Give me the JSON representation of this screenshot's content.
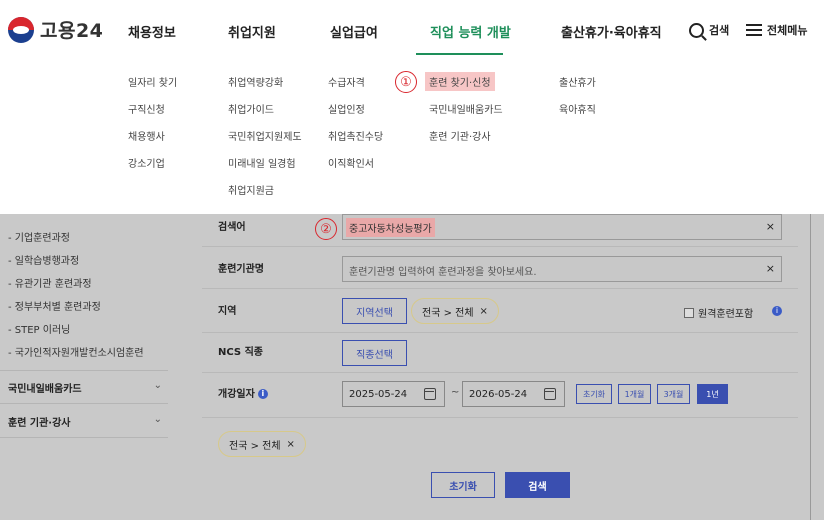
{
  "header": {
    "logo_text": "고용24",
    "nav": [
      "채용정보",
      "취업지원",
      "실업급여",
      "직업 능력 개발",
      "출산휴가·육아휴직"
    ],
    "search_label": "검색",
    "all_menu_label": "전체메뉴"
  },
  "mega_menu": {
    "col1": [
      "일자리 찾기",
      "구직신청",
      "채용행사",
      "강소기업"
    ],
    "col2": [
      "취업역량강화",
      "취업가이드",
      "국민취업지원제도",
      "미래내일 일경험",
      "취업지원금"
    ],
    "col3": [
      "수급자격",
      "실업인정",
      "취업촉진수당",
      "이직확인서"
    ],
    "col4": [
      "훈련 찾기·신청",
      "국민내일배움카드",
      "훈련 기관·강사"
    ],
    "col5": [
      "출산휴가",
      "육아휴직"
    ],
    "marker1": "①",
    "marker2": "②"
  },
  "sidebar": {
    "items": [
      "- 기업훈련과정",
      "- 일학습병행과정",
      "- 유관기관 훈련과정",
      "- 정부부처별 훈련과정",
      "- STEP 이러닝",
      "- 국가인적자원개발컨소시엄훈련"
    ],
    "groups": [
      "국민내일배움카드",
      "훈련 기관·강사"
    ]
  },
  "form": {
    "keyword_label": "검색어",
    "keyword_value": "중고자동차성능평가",
    "institution_label": "훈련기관명",
    "institution_placeholder": "훈련기관명 입력하여 훈련과정을 찾아보세요.",
    "region_label": "지역",
    "region_button": "지역선택",
    "region_chip": "전국 > 전체",
    "remote_checkbox": "원격훈련포함",
    "ncs_label": "NCS 직종",
    "ncs_button": "직종선택",
    "date_label": "개강일자",
    "date_from": "2025-05-24",
    "date_sep": "~",
    "date_to": "2026-05-24",
    "periods": [
      "초기화",
      "1개월",
      "3개월",
      "1년"
    ],
    "summary_chip": "전국 > 전체",
    "reset_button": "초기화",
    "search_button": "검색",
    "clear_glyph": "×",
    "info_glyph": "i",
    "chevron_glyph": "⌄"
  },
  "colors": {
    "accent_green": "#1e8f5a",
    "primary_blue": "#3a4fb0",
    "highlight_pink": "#f7c6c6",
    "marker_red": "#d9262d"
  }
}
